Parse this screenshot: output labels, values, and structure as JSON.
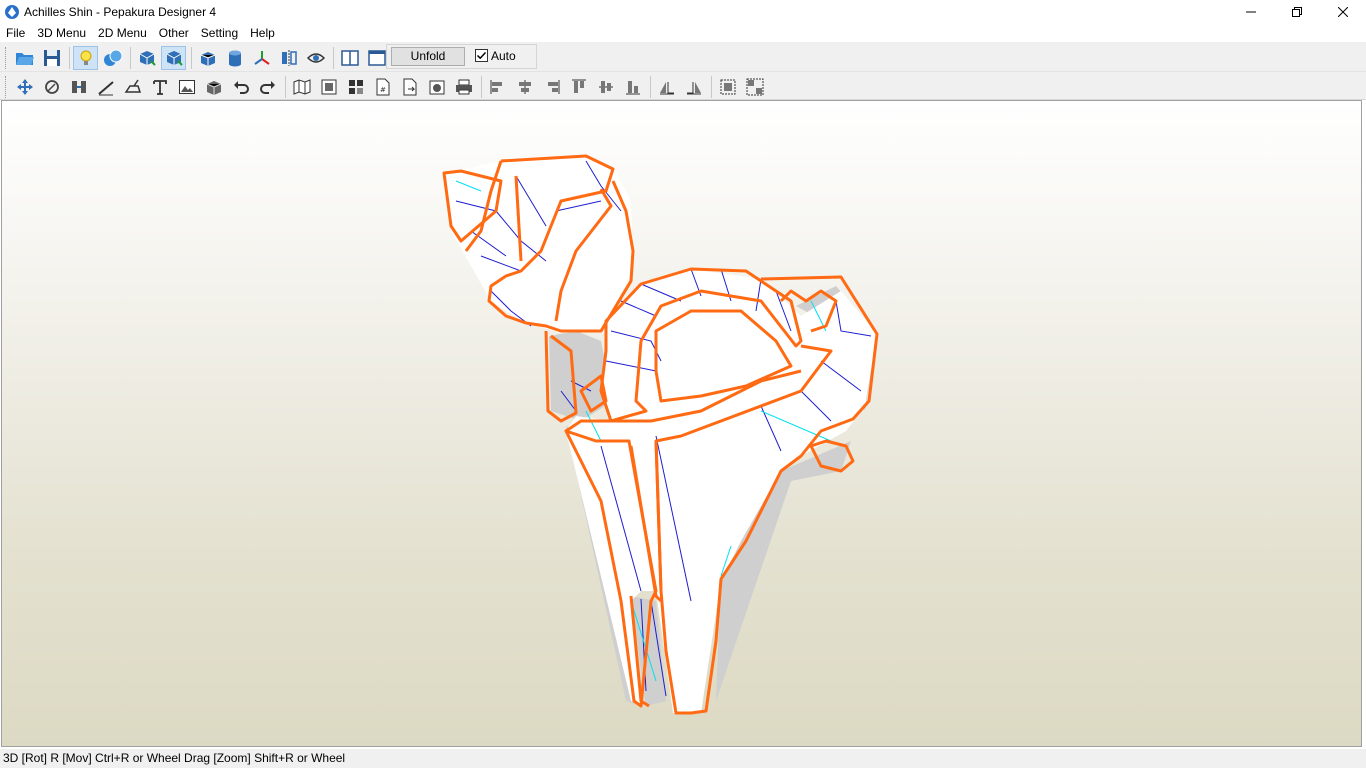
{
  "window": {
    "title": "Achilles Shin - Pepakura Designer 4",
    "controls": [
      "minimize-icon",
      "restore-icon",
      "close-icon"
    ]
  },
  "menu": {
    "items": [
      "File",
      "3D Menu",
      "2D Menu",
      "Other",
      "Setting",
      "Help"
    ]
  },
  "toolbar1": {
    "buttons": [
      "open-icon",
      "save-icon",
      "light-icon",
      "texture-icon",
      "view-front-icon",
      "view-select-icon",
      "box-icon",
      "cylinder-icon",
      "axis-icon",
      "mirror-icon",
      "eye-icon",
      "layout-split-icon",
      "layout-single-icon"
    ],
    "unfold_label": "Unfold",
    "auto_label": "Auto",
    "auto_checked": true
  },
  "toolbar2": {
    "buttons": [
      "move-tool-icon",
      "rotate-tool-icon",
      "join-tool-icon",
      "fold-line-icon",
      "flap-icon",
      "text-tool-icon",
      "image-tool-icon",
      "part-icon",
      "undo-icon",
      "redo-icon",
      "map-icon",
      "arrange-icon",
      "grid-icon",
      "page-number-icon",
      "export-icon",
      "camera-icon",
      "print-icon",
      "align-left-icon",
      "align-center-icon",
      "align-right-icon",
      "align-top-icon",
      "align-middle-icon",
      "align-bottom-icon",
      "flip-h-icon",
      "flip-v-icon",
      "group-icon",
      "ungroup-icon"
    ]
  },
  "statusbar": {
    "text": "3D [Rot] R [Mov] Ctrl+R or Wheel Drag [Zoom] Shift+R or Wheel"
  },
  "colors": {
    "edge_cut": "#ff6a13",
    "edge_fold": "#0000cc",
    "edge_valley": "#00e5ee",
    "face": "#ffffff",
    "face_back": "#c9c9c9"
  }
}
